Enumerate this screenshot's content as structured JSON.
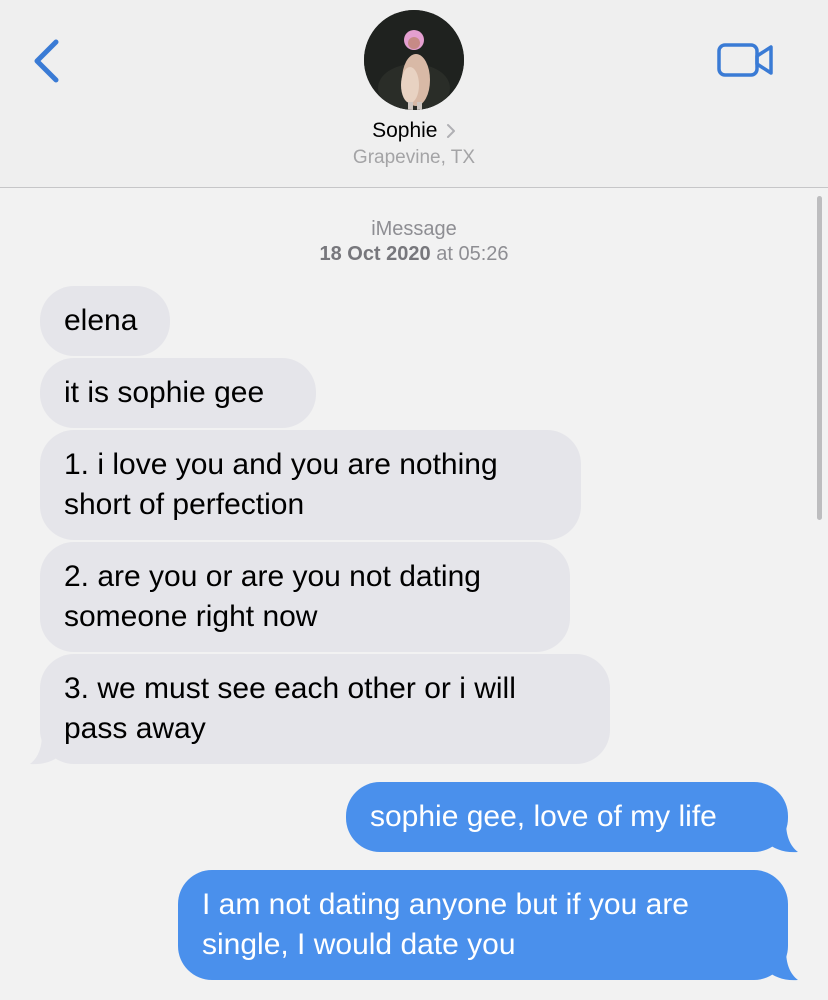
{
  "header": {
    "contact_name": "Sophie",
    "location": "Grapevine, TX"
  },
  "conversation": {
    "service": "iMessage",
    "date": "18 Oct 2020",
    "at": "at",
    "time": "05:26"
  },
  "messages": [
    {
      "direction": "incoming",
      "lines": [
        "elena"
      ]
    },
    {
      "direction": "incoming",
      "lines": [
        "it is sophie gee"
      ]
    },
    {
      "direction": "incoming",
      "lines": [
        "1. i love you and you are nothing",
        "short of perfection"
      ]
    },
    {
      "direction": "incoming",
      "lines": [
        "2. are you or are you not dating",
        "someone right now"
      ]
    },
    {
      "direction": "incoming",
      "lines": [
        "3. we must see each other or i will",
        "pass away"
      ]
    },
    {
      "direction": "outgoing",
      "lines": [
        "sophie gee, love of my life"
      ]
    },
    {
      "direction": "outgoing",
      "lines": [
        "I am not dating anyone but if you are",
        "single, I would date you"
      ]
    }
  ],
  "colors": {
    "accent": "#3a7bd5",
    "incoming_bubble": "#e5e5ea",
    "outgoing_bubble": "#4a90ec"
  },
  "icons": {
    "back": "chevron-left-icon",
    "video": "video-camera-icon",
    "contact_chevron": "chevron-right-icon"
  }
}
